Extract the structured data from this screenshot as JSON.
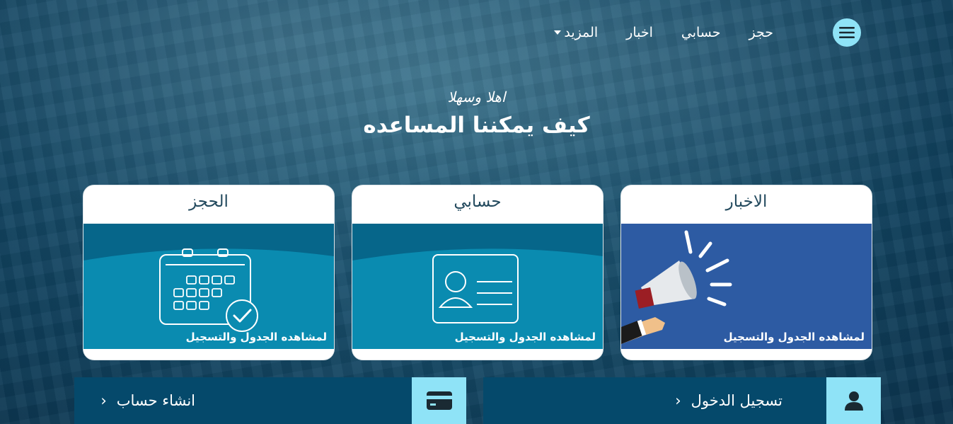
{
  "nav": {
    "items": [
      {
        "label": "حجز"
      },
      {
        "label": "حسابي"
      },
      {
        "label": "اخبار"
      },
      {
        "label": "المزيد"
      }
    ]
  },
  "hero": {
    "greeting": "اهلا وسهلا",
    "headline": "كيف يمكننا المساعده"
  },
  "cards": [
    {
      "title": "الاخبار",
      "caption": "لمشاهده الجدول والتسجيل",
      "icon": "megaphone-icon"
    },
    {
      "title": "حسابي",
      "caption": "لمشاهده الجدول والتسجيل",
      "icon": "id-card-icon"
    },
    {
      "title": "الحجز",
      "caption": "لمشاهده الجدول والتسجيل",
      "icon": "calendar-check-icon"
    }
  ],
  "buttons": {
    "login": {
      "label": "تسجيل الدخول",
      "icon": "user-icon"
    },
    "signup": {
      "label": "انشاء حساب",
      "icon": "credit-card-icon"
    }
  },
  "colors": {
    "accent": "#8fe3f7",
    "teal": "#0a8bb0",
    "blue": "#2d5ba3",
    "dark": "#05496b"
  }
}
